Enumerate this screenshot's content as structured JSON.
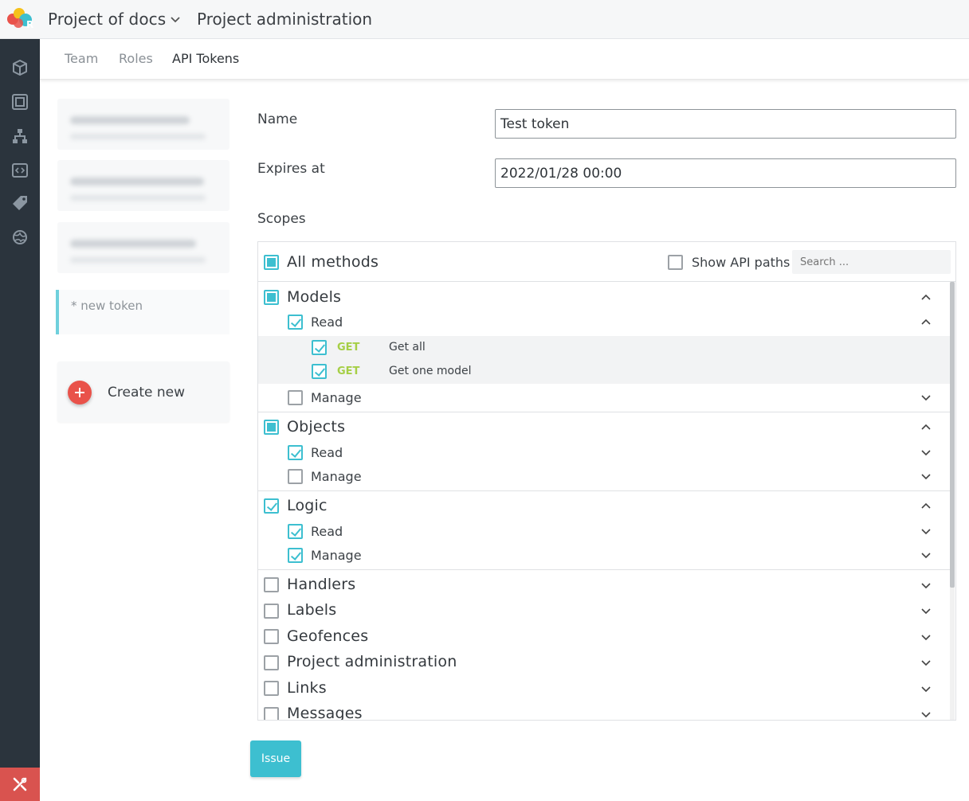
{
  "header": {
    "project_name": "Project of docs",
    "page_title": "Project administration"
  },
  "sidebar": {
    "icons": [
      "cube-icon",
      "frame-icon",
      "sitemap-icon",
      "code-icon",
      "tag-icon",
      "globe-icon"
    ],
    "bottom_icon": "tools-icon"
  },
  "tabs": [
    {
      "label": "Team"
    },
    {
      "label": "Roles"
    },
    {
      "label": "API Tokens",
      "active": true
    }
  ],
  "tokens": {
    "new_token_label": "* new token",
    "create_label": "Create new"
  },
  "form": {
    "name_label": "Name",
    "name_value": "Test token",
    "expires_label": "Expires at",
    "expires_value": "2022/01/28 00:00",
    "scopes_label": "Scopes"
  },
  "scopes": {
    "all_methods_label": "All methods",
    "show_paths_label": "Show API paths",
    "search_placeholder": "Search ...",
    "groups": {
      "models": {
        "label": "Models",
        "read": "Read",
        "manage": "Manage",
        "methods": [
          {
            "verb": "GET",
            "desc": "Get all"
          },
          {
            "verb": "GET",
            "desc": "Get one model"
          }
        ]
      },
      "objects": {
        "label": "Objects",
        "read": "Read",
        "manage": "Manage"
      },
      "logic": {
        "label": "Logic",
        "read": "Read",
        "manage": "Manage"
      },
      "handlers": {
        "label": "Handlers"
      },
      "labels": {
        "label": "Labels"
      },
      "geofences": {
        "label": "Geofences"
      },
      "project_admin": {
        "label": "Project administration"
      },
      "links": {
        "label": "Links"
      },
      "messages": {
        "label": "Messages"
      }
    }
  },
  "actions": {
    "issue_label": "Issue"
  },
  "colors": {
    "accent": "#3dbfd0",
    "sidebar_bg": "#2b343d",
    "danger": "#e9524a",
    "get_verb": "#a6cf46"
  }
}
